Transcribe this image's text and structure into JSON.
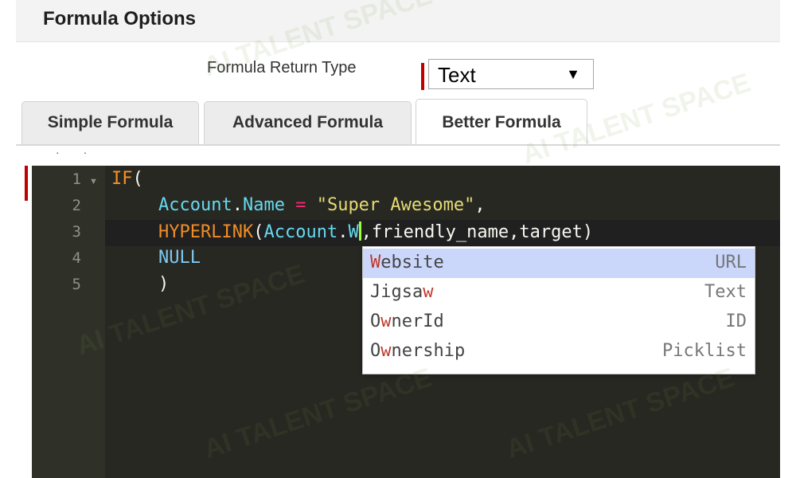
{
  "header": {
    "title": "Formula Options"
  },
  "return_type": {
    "label": "Formula Return Type",
    "value": "Text",
    "arrow": "▼"
  },
  "tabs": [
    {
      "label": "Simple Formula",
      "active": false
    },
    {
      "label": "Advanced Formula",
      "active": false
    },
    {
      "label": "Better Formula",
      "active": true
    }
  ],
  "editor": {
    "line_numbers": [
      "1",
      "2",
      "3",
      "4",
      "5"
    ],
    "fold_icon": "fold-arrow-icon",
    "lines": {
      "l1": {
        "kw": "IF",
        "paren": "("
      },
      "l2": {
        "obj": "Account",
        "dot": ".",
        "field": "Name",
        "op": " = ",
        "str": "\"Super Awesome\"",
        "comma": ","
      },
      "l3": {
        "fn": "HYPERLINK",
        "paren": "(",
        "obj": "Account",
        "dot": ".",
        "typed": "W",
        "rest": ",friendly_name,target)"
      },
      "l4": {
        "null": "NULL"
      },
      "l5": {
        "paren": ")"
      }
    }
  },
  "autocomplete": {
    "items": [
      {
        "pre": "",
        "hl": "W",
        "post": "ebsite",
        "type": "URL",
        "selected": true
      },
      {
        "pre": "Jigsa",
        "hl": "w",
        "post": "",
        "type": "Text",
        "selected": false
      },
      {
        "pre": "O",
        "hl": "w",
        "post": "nerId",
        "type": "ID",
        "selected": false
      },
      {
        "pre": "O",
        "hl": "w",
        "post": "nership",
        "type": "Picklist",
        "selected": false
      }
    ]
  },
  "watermark": {
    "text": "AI TALENT SPACE"
  },
  "colors": {
    "accent_required": "#c00000",
    "editor_bg": "#272822",
    "selected_suggestion": "#cad6fa",
    "caret": "#9cff38"
  }
}
